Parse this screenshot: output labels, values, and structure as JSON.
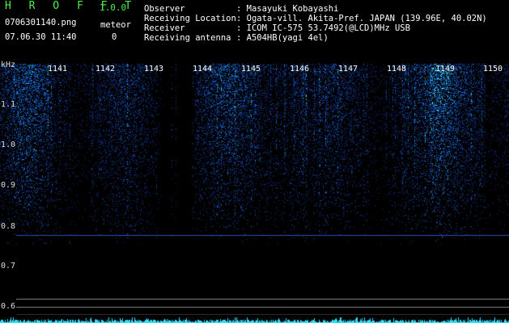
{
  "header": {
    "app_name": "H R O F F T",
    "version": "1.0.0",
    "filename": "0706301140.png",
    "meteor_label": "meteor",
    "meteor_count": "0",
    "datetime": "07.06.30 11:40",
    "fields": [
      {
        "key": "Observer",
        "value": ": Masayuki Kobayashi"
      },
      {
        "key": "Receiving Location",
        "value": ": Ogata-vill. Akita-Pref. JAPAN (139.96E, 40.02N)"
      },
      {
        "key": "Receiver",
        "value": ": ICOM IC-575 53.7492(@LCD)MHz USB"
      },
      {
        "key": "Receiving antenna",
        "value": ": A504HB(yagi 4el)"
      }
    ]
  },
  "spectrogram": {
    "y_unit": "kHz",
    "y_ticks": [
      "1.1",
      "1.0",
      "0.9",
      "0.8",
      "0.7",
      "0.6"
    ],
    "time_ticks": [
      "1141",
      "1142",
      "1143",
      "1144",
      "1145",
      "1146",
      "1147",
      "1148",
      "1149",
      "1150"
    ],
    "colors": {
      "background": "#000000",
      "signal_low": "#1020a0",
      "signal_high": "#40ffff",
      "trace": "#30e0ff"
    }
  }
}
